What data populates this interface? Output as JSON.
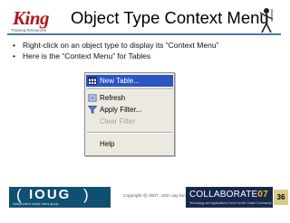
{
  "header": {
    "logo_text": "King",
    "logo_subtext": "Training Resources",
    "title": "Object Type Context Menu"
  },
  "bullets": [
    "Right-click on an object type to display its “Context Menu”",
    "Here is the “Context Menu” for Tables"
  ],
  "context_menu": {
    "items": [
      {
        "label": "New Table...",
        "icon": "table-grid-icon",
        "state": "selected"
      },
      {
        "label": "Refresh",
        "icon": "refresh-icon",
        "state": "enabled"
      },
      {
        "label": "Apply Filter...",
        "icon": "filter-funnel-icon",
        "state": "enabled"
      },
      {
        "label": "Clear Filter",
        "icon": "",
        "state": "disabled"
      },
      {
        "label": "Help",
        "icon": "",
        "state": "enabled"
      }
    ]
  },
  "footer": {
    "ioug_logo": "IOUG",
    "ioug_tagline": "independent oracle users group",
    "copyright": "Copyright @ 2007, John Jay King",
    "collab_logo": "COLLABORATE",
    "collab_year": "07",
    "collab_tagline": "Technology and Applications Forum for the Oracle Community",
    "page_number": "36"
  },
  "colors": {
    "title_rule": "#4a7aa8",
    "menu_background": "#ece9e1",
    "menu_selected": "#2a55c2",
    "disabled_text": "#a4a29d",
    "ioug_blue": "#0f5072",
    "collab_navy": "#16284c",
    "page_badge": "#d8cc8c"
  }
}
